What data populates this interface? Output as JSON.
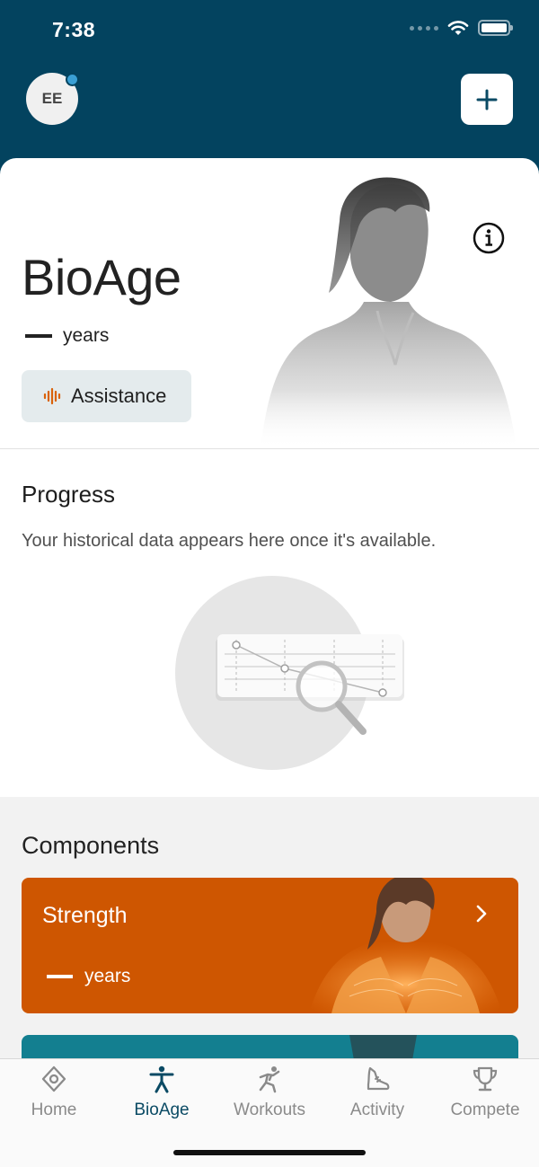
{
  "status_bar": {
    "time": "7:38"
  },
  "header": {
    "avatar_initials": "EE"
  },
  "hero": {
    "title": "BioAge",
    "years_label": "years",
    "assistance_label": "Assistance"
  },
  "progress": {
    "title": "Progress",
    "description": "Your historical data appears here once it's available."
  },
  "components": {
    "title": "Components",
    "cards": [
      {
        "name": "Strength",
        "years_label": "years",
        "color": "#ce5601"
      },
      {
        "color": "#137f90"
      }
    ]
  },
  "tabbar": {
    "tabs": [
      {
        "label": "Home",
        "icon": "home-icon",
        "active": false
      },
      {
        "label": "BioAge",
        "icon": "person-icon",
        "active": true
      },
      {
        "label": "Workouts",
        "icon": "workouts-icon",
        "active": false
      },
      {
        "label": "Activity",
        "icon": "activity-icon",
        "active": false
      },
      {
        "label": "Compete",
        "icon": "trophy-icon",
        "active": false
      }
    ]
  },
  "colors": {
    "header_bg": "#03435f",
    "accent_orange": "#ce5601",
    "notification_dot": "#3a9fd4",
    "active_tab": "#0a4a64"
  }
}
